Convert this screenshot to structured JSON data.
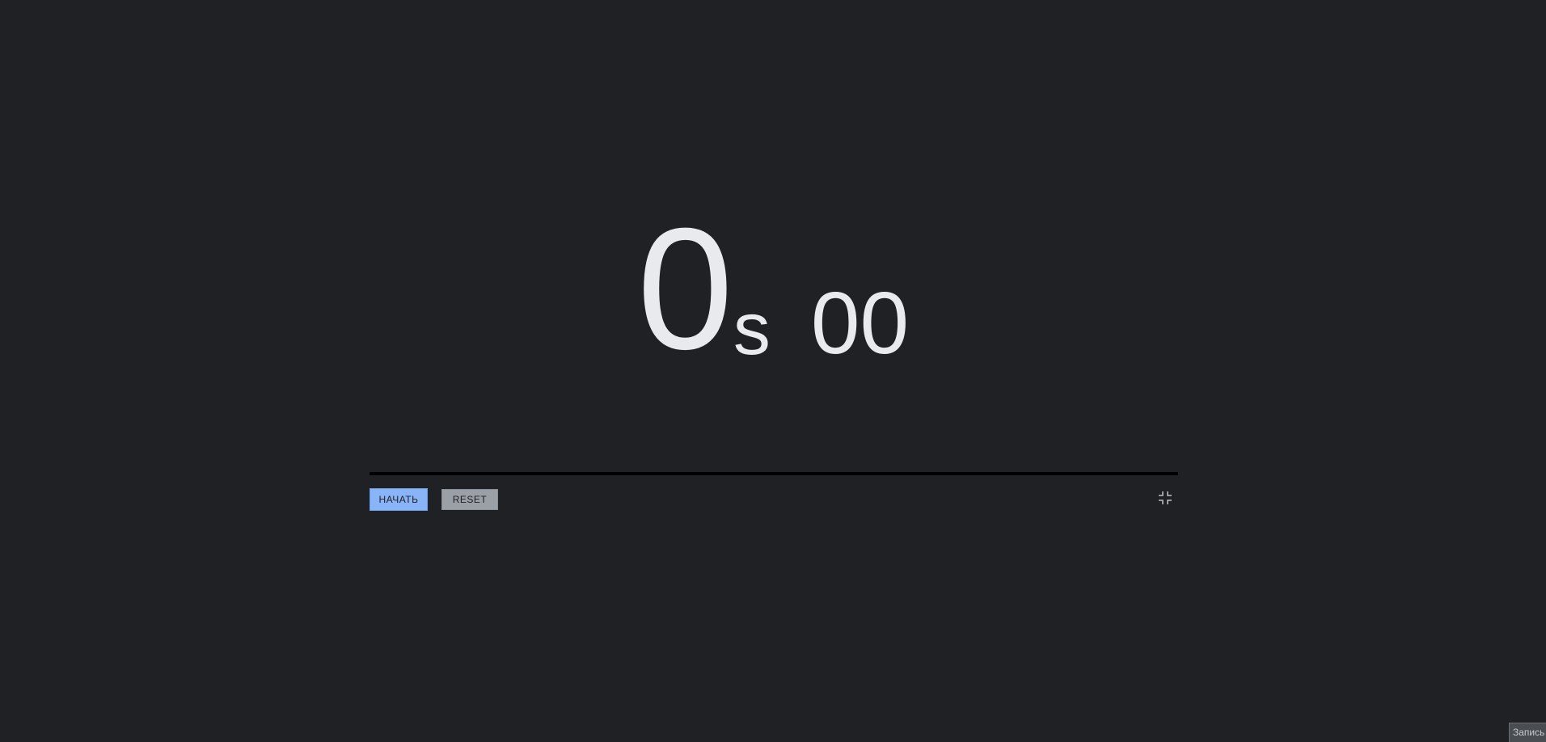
{
  "timer": {
    "seconds": "0",
    "seconds_unit": "s",
    "centiseconds": "00"
  },
  "progress": {
    "fraction": 0
  },
  "controls": {
    "start_label": "НАЧАТЬ",
    "reset_label": "RESET",
    "fullscreen_icon": "collapse-fullscreen-icon"
  },
  "corner_tab": {
    "label": "Запись"
  },
  "colors": {
    "background": "#202124",
    "text": "#e8eaed",
    "start_button": "#8ab4f8",
    "reset_button": "#9aa0a6",
    "progress_track": "#000000"
  }
}
